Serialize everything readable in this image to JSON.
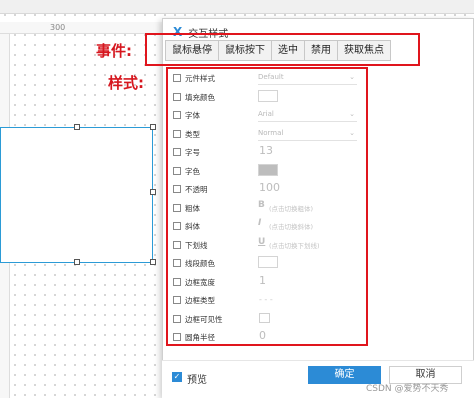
{
  "ruler": {
    "tick": "300"
  },
  "annotations": {
    "events_label": "事件:",
    "styles_label": "样式:"
  },
  "dialog": {
    "logo": "X",
    "title": "交互样式",
    "tabs": [
      "鼠标悬停",
      "鼠标按下",
      "选中",
      "禁用",
      "获取焦点"
    ]
  },
  "properties": [
    {
      "label": "元件样式",
      "kind": "select",
      "value": "Default"
    },
    {
      "label": "填充颜色",
      "kind": "swatch"
    },
    {
      "label": "字体",
      "kind": "select",
      "value": "Arial"
    },
    {
      "label": "类型",
      "kind": "select",
      "value": "Normal"
    },
    {
      "label": "字号",
      "kind": "number",
      "value": "13"
    },
    {
      "label": "字色",
      "kind": "swatch-filled"
    },
    {
      "label": "不透明",
      "kind": "number",
      "value": "100"
    },
    {
      "label": "粗体",
      "kind": "style",
      "glyph": "B",
      "hint": "(点击切换粗体)"
    },
    {
      "label": "斜体",
      "kind": "style",
      "glyph": "I",
      "hint": "(点击切换斜体)"
    },
    {
      "label": "下划线",
      "kind": "style",
      "glyph": "U",
      "hint": "(点击切换下划线)"
    },
    {
      "label": "线段颜色",
      "kind": "swatch"
    },
    {
      "label": "边框宽度",
      "kind": "number",
      "value": "1"
    },
    {
      "label": "边框类型",
      "kind": "dash",
      "value": "- - -"
    },
    {
      "label": "边框可见性",
      "kind": "box"
    },
    {
      "label": "圆角半径",
      "kind": "number",
      "value": "0"
    }
  ],
  "footer": {
    "preview_label": "预览",
    "preview_checked": true,
    "ok_label": "确定",
    "cancel_label": "取消"
  },
  "watermark": "CSDN @爱势不天秀",
  "colors": {
    "accent": "#2c8bd6",
    "annotation_red": "#e0151d"
  }
}
